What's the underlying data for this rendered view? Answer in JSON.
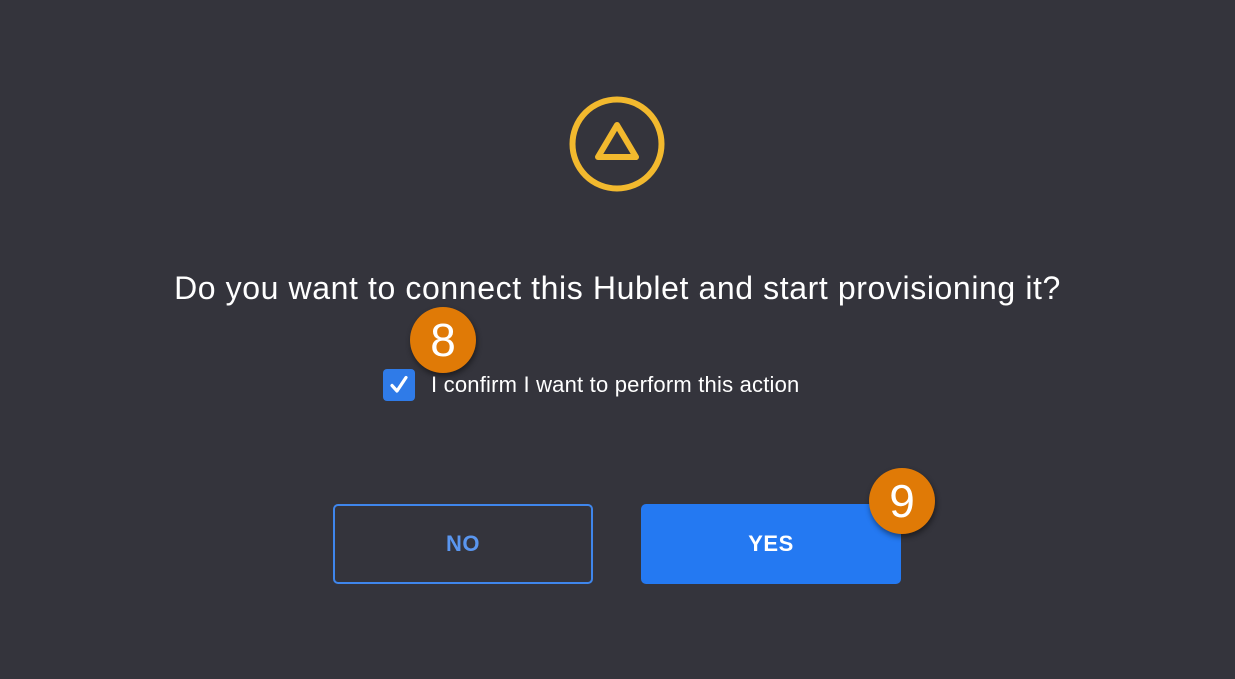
{
  "dialog": {
    "question": "Do you want to connect this Hublet and start provisioning it?",
    "icon": "warning-triangle-circle-icon",
    "confirm": {
      "label": "I confirm I want to perform this action",
      "checked": true
    },
    "buttons": {
      "no_label": "NO",
      "yes_label": "YES"
    }
  },
  "annotations": {
    "step_8": "8",
    "step_9": "9"
  },
  "colors": {
    "background": "#34343c",
    "warning": "#f2b92e",
    "primary": "#2479f2",
    "badge": "#e07a06",
    "text": "#ffffff"
  }
}
